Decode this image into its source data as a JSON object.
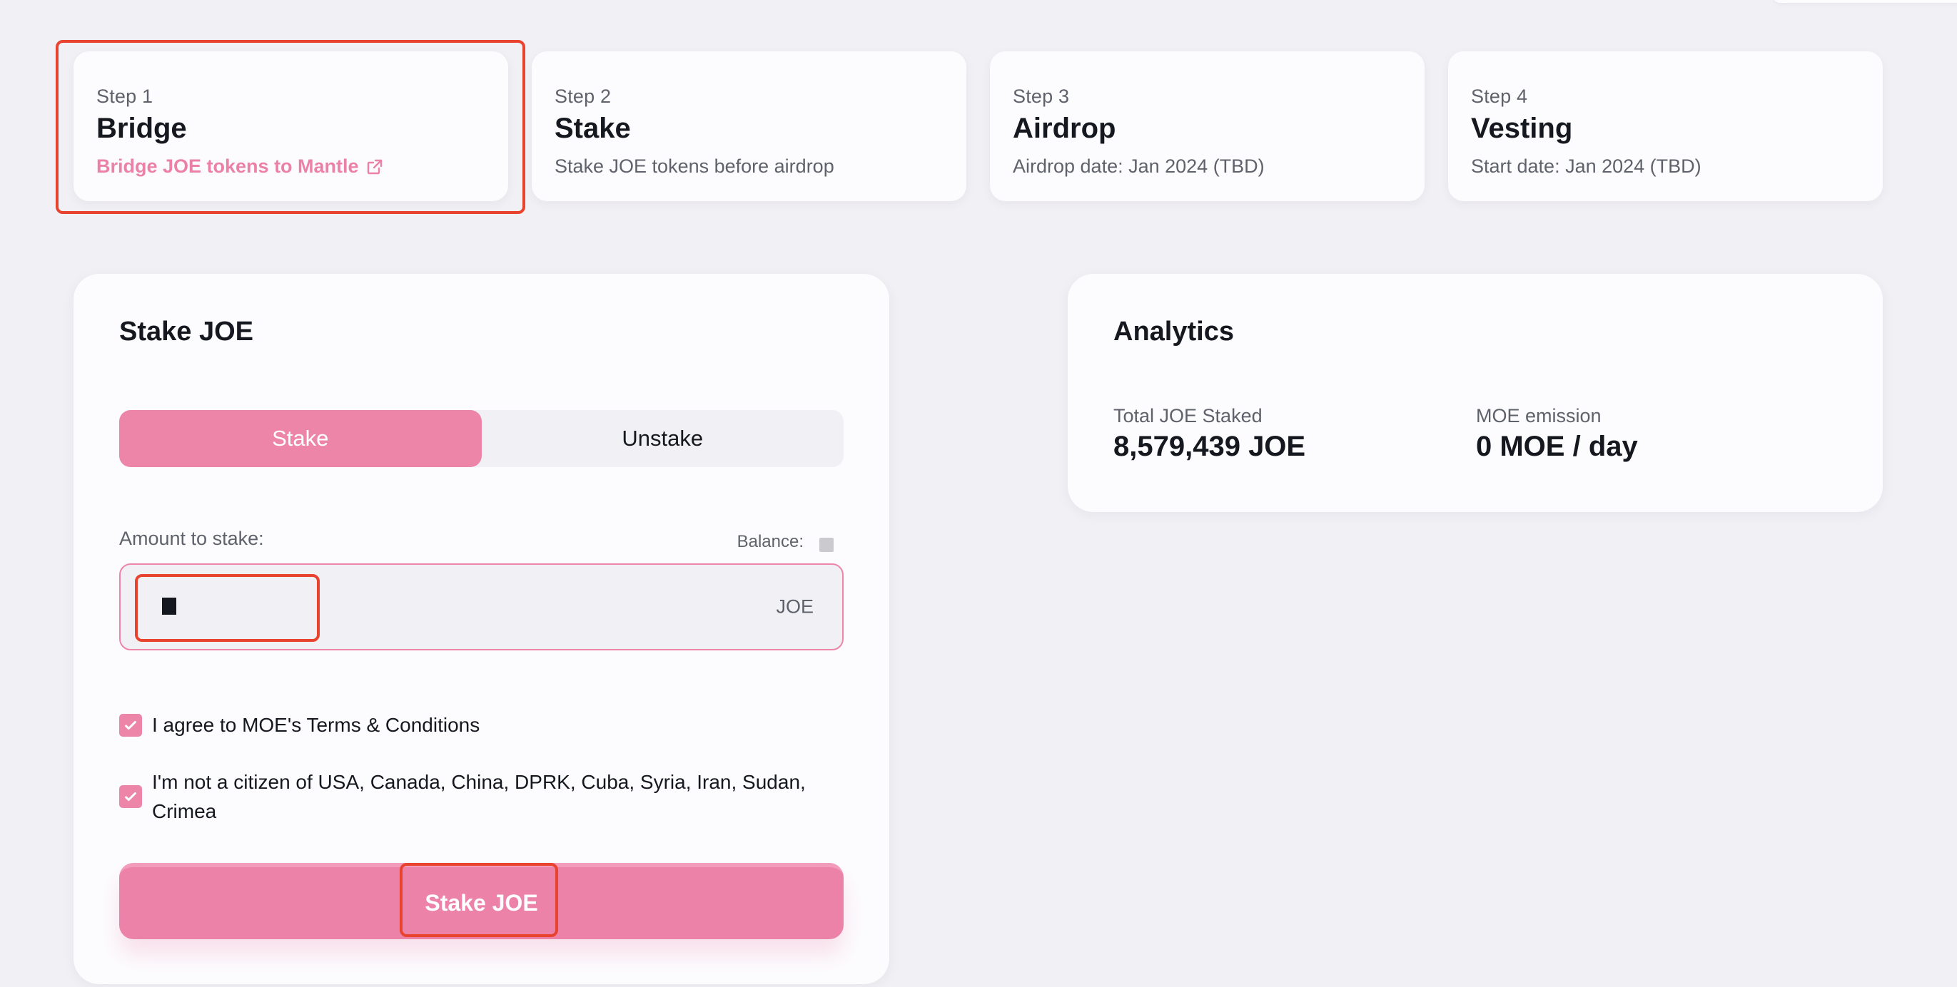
{
  "steps": [
    {
      "step": "Step 1",
      "title": "Bridge",
      "description": "Bridge JOE tokens to Mantle",
      "is_link": true,
      "icon": "external-link-icon"
    },
    {
      "step": "Step 2",
      "title": "Stake",
      "description": "Stake JOE tokens before airdrop",
      "is_link": false
    },
    {
      "step": "Step 3",
      "title": "Airdrop",
      "description": "Airdrop date: Jan 2024 (TBD)",
      "is_link": false
    },
    {
      "step": "Step 4",
      "title": "Vesting",
      "description": "Start date: Jan 2024 (TBD)",
      "is_link": false
    }
  ],
  "stake_panel": {
    "title": "Stake JOE",
    "tabs": [
      {
        "label": "Stake",
        "active": true
      },
      {
        "label": "Unstake",
        "active": false
      }
    ],
    "amount_label": "Amount to stake:",
    "balance_label": "Balance:",
    "amount_value": "",
    "amount_suffix": "JOE",
    "checkboxes": [
      {
        "label": "I agree to MOE's Terms & Conditions",
        "checked": true
      },
      {
        "label": "I'm not a citizen of USA, Canada, China, DPRK, Cuba, Syria, Iran, Sudan, Crimea",
        "checked": true
      }
    ],
    "submit_label": "Stake JOE"
  },
  "analytics": {
    "title": "Analytics",
    "stats": [
      {
        "label": "Total JOE Staked",
        "value": "8,579,439 JOE"
      },
      {
        "label": "MOE emission",
        "value": "0 MOE / day"
      }
    ]
  },
  "colors": {
    "accent": "#ec85a8",
    "background": "#f1f0f5",
    "card": "#fcfcfe",
    "text_primary": "#16181f",
    "text_secondary": "#5f626b",
    "highlight": "#e8432f"
  }
}
